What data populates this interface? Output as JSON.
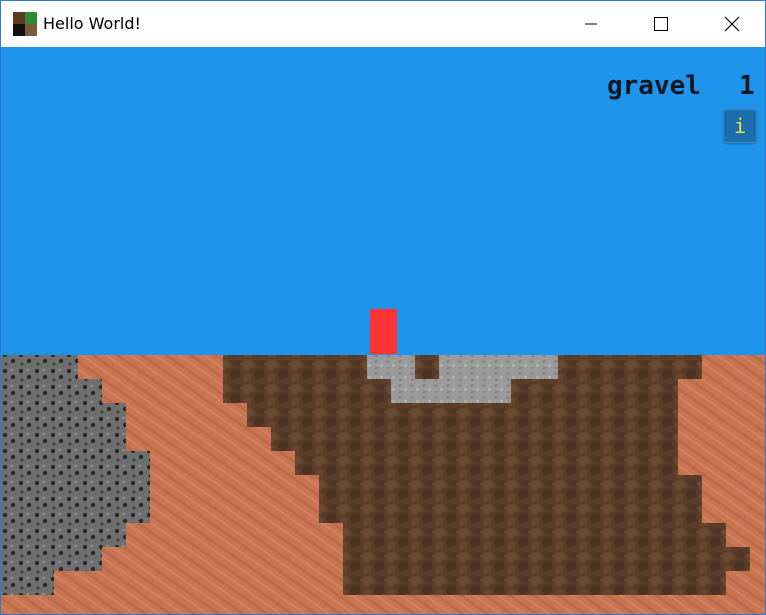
{
  "window": {
    "title": "Hello World!",
    "icon": "grass-block-icon",
    "controls": [
      "minimize-icon",
      "maximize-icon",
      "close-icon"
    ]
  },
  "hud": {
    "selected_item": "gravel",
    "item_count": "1",
    "info_button_label": "i"
  },
  "colors": {
    "sky": "#1e95ea",
    "dirt": "#c97552",
    "wood": "#5a3d29",
    "gravel": "#9a9a9a",
    "stone": "#6f6f6f",
    "player": "#ff3333",
    "hud_text": "#0e1722",
    "info_button": "#1b6fae",
    "info_text": "#f2e43a"
  }
}
